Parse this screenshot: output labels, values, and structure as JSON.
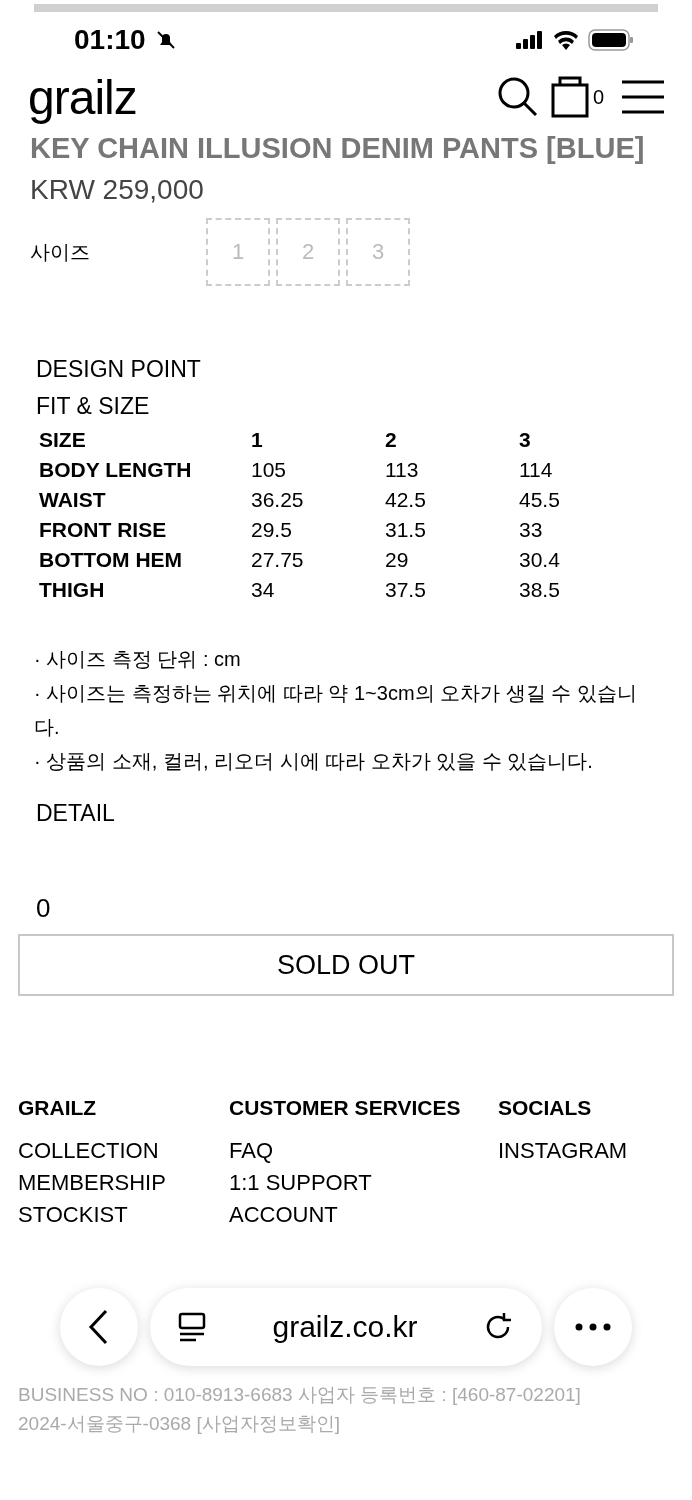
{
  "status_bar": {
    "time": "01:10"
  },
  "header": {
    "logo": "grailz",
    "cart_count": "0"
  },
  "product": {
    "title": "KEY CHAIN ILLUSION DENIM PANTS [BLUE]",
    "price": "KRW 259,000",
    "size_label": "사이즈",
    "sizes": [
      {
        "label": "1",
        "disabled": true
      },
      {
        "label": "2",
        "disabled": true
      },
      {
        "label": "3",
        "disabled": true
      }
    ]
  },
  "design_point": {
    "title": "DESIGN POINT"
  },
  "fit_size": {
    "title": "FIT & SIZE",
    "columns": [
      "SIZE",
      "1",
      "2",
      "3"
    ],
    "rows": [
      [
        "BODY LENGTH",
        "105",
        "113",
        "114"
      ],
      [
        "WAIST",
        "36.25",
        "42.5",
        "45.5"
      ],
      [
        "FRONT RISE",
        "29.5",
        "31.5",
        "33"
      ],
      [
        "BOTTOM HEM",
        "27.75",
        "29",
        "30.4"
      ],
      [
        "THIGH",
        "34",
        "37.5",
        "38.5"
      ]
    ],
    "notes": [
      "· 사이즈 측정 단위 : cm",
      "· 사이즈는 측정하는 위치에 따라 약 1~3cm의 오차가 생길 수 있습니다.",
      "· 상품의 소재, 컬러, 리오더 시에 따라 오차가 있을 수 있습니다."
    ]
  },
  "detail": {
    "title": "DETAIL"
  },
  "quantity": "0",
  "sold_out_button": "SOLD OUT",
  "footer": {
    "columns": [
      {
        "title": "GRAILZ",
        "links": [
          "COLLECTION",
          "MEMBERSHIP",
          "STOCKIST"
        ]
      },
      {
        "title": "CUSTOMER SERVICES",
        "links": [
          "FAQ",
          "1:1 SUPPORT",
          "ACCOUNT"
        ]
      },
      {
        "title": "SOCIALS",
        "links": [
          "INSTAGRAM"
        ]
      }
    ],
    "business_lines": [
      "BUSINESS NO : 010-8913-6683 사업자 등록번호 : [460-87-02201]",
      "2024-서울중구-0368 [사업자정보확인]"
    ]
  },
  "browser_bar": {
    "url": "grailz.co.kr"
  }
}
